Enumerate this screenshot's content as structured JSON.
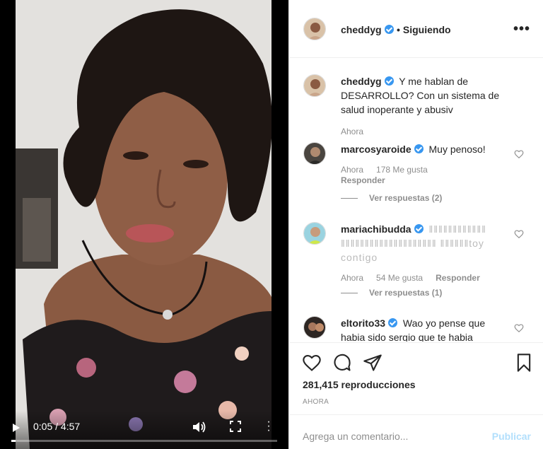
{
  "video": {
    "current_time": "0:05",
    "separator": "/",
    "duration": "4:57",
    "progress_fraction": 0.017
  },
  "post": {
    "author": "cheddyg",
    "dot": "•",
    "follow_status": "Siguiendo",
    "more_label": "•••",
    "caption": "Y me hablan de DESARROLLO? Con un sistema de salud inoperante y abusiv",
    "caption_time": "Ahora"
  },
  "comments": [
    {
      "user": "marcosyaroide",
      "text": "Muy penoso!",
      "time": "Ahora",
      "likes": "178 Me gusta",
      "reply_label": "Responder",
      "view_replies": "Ver respuestas (2)"
    },
    {
      "user": "mariachibudda",
      "text": "‖‖‖‖‖‖‖‖‖‖‖‖ ‖‖‖‖‖‖‖‖‖‖‖‖‖‖‖‖‖‖‖‖ ‖‖‖‖‖‖toy contigo",
      "time": "Ahora",
      "likes": "54 Me gusta",
      "reply_label": "Responder",
      "view_replies": "Ver respuestas (1)"
    },
    {
      "user": "eltorito33",
      "text": "Wao yo pense que habia sido sergio que te habia"
    }
  ],
  "actions": {
    "views": "281,415 reproducciones",
    "posted": "AHORA"
  },
  "add_comment": {
    "placeholder": "Agrega un comentario...",
    "publish_label": "Publicar"
  },
  "colors": {
    "verified": "#3897f0",
    "muted": "#8e8e8e",
    "publish_disabled": "#b2dffc"
  }
}
